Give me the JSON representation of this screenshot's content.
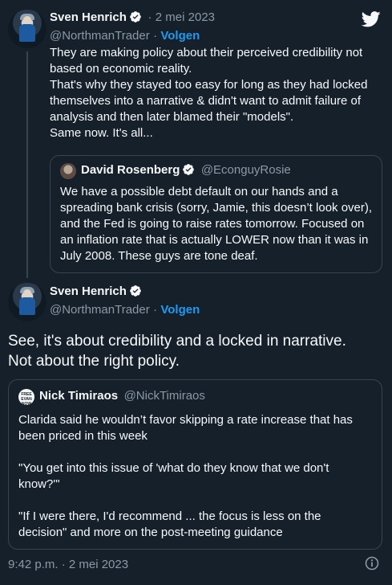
{
  "tweet1": {
    "author_name": "Sven Henrich",
    "dot": "·",
    "date": "2 mei 2023",
    "handle": "@NorthmanTrader",
    "follow_label": "Volgen",
    "text": "They are making policy about their perceived credibility not based on economic reality.\nThat's why they stayed too easy for long as they had locked themselves into a narrative & didn't want to admit failure of analysis and then later blamed their \"models\".\nSame now. It's all...",
    "quote": {
      "author_name": "David Rosenberg",
      "handle": "@EconguyRosie",
      "text": "We have a possible debt default on our hands and a spreading bank crisis (sorry, Jamie, this doesn’t look over), and the Fed is going to raise rates tomorrow. Focused on an inflation rate that is actually LOWER now than it was in July 2008. These guys are tone deaf."
    }
  },
  "tweet2": {
    "author_name": "Sven Henrich",
    "handle": "@NorthmanTrader",
    "follow_label": "Volgen",
    "text": "See, it's about credibility and a locked in narrative.\nNot about the right policy.",
    "quote": {
      "author_name": "Nick Timiraos",
      "handle": "@NickTimiraos",
      "avatar_text": "FREE EVAN NOW",
      "text": "Clarida said he wouldn’t favor skipping a rate increase that has been priced in this week\n\n\"You get into this issue of 'what do they know that we don't know?'\"\n\n\"If I were there, I'd recommend ... the focus is less on the decision\" and more on the post-meeting guidance"
    },
    "timestamp": "9:42 p.m. · 2 mei 2023"
  },
  "icons": {
    "brand": "twitter-bird-icon",
    "verified": "verified-badge-icon",
    "info": "info-icon"
  },
  "colors": {
    "background": "#15202b",
    "accent": "#1d9bf0",
    "muted": "#8b98a5",
    "border": "#38444d"
  }
}
